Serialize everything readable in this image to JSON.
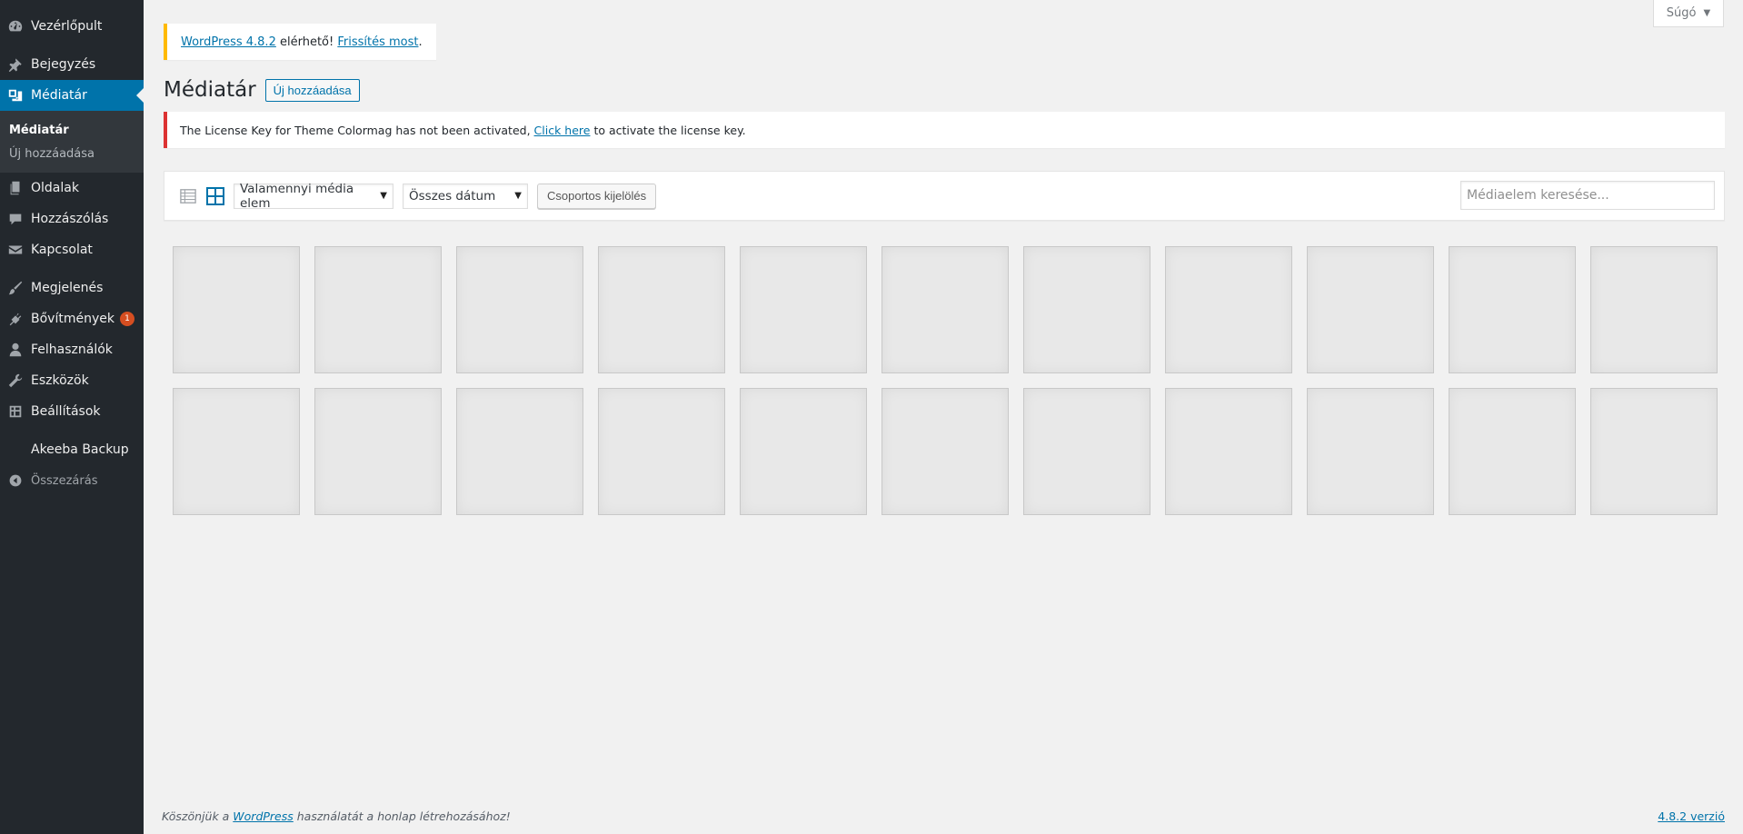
{
  "sidebar": {
    "items": [
      {
        "label": "Vezérlőpult",
        "icon": "dashboard-icon"
      },
      {
        "label": "Bejegyzés",
        "icon": "pin-icon"
      },
      {
        "label": "Médiatár",
        "icon": "media-icon"
      },
      {
        "label": "Oldalak",
        "icon": "pages-icon"
      },
      {
        "label": "Hozzászólás",
        "icon": "comments-icon"
      },
      {
        "label": "Kapcsolat",
        "icon": "mail-icon"
      },
      {
        "label": "Megjelenés",
        "icon": "brush-icon"
      },
      {
        "label": "Bővítmények",
        "icon": "plugins-icon",
        "badge": "1"
      },
      {
        "label": "Felhasználók",
        "icon": "users-icon"
      },
      {
        "label": "Eszközök",
        "icon": "tools-icon"
      },
      {
        "label": "Beállítások",
        "icon": "settings-icon"
      },
      {
        "label": "Akeeba Backup",
        "icon": ""
      },
      {
        "label": "Összezárás",
        "icon": "collapse-icon"
      }
    ],
    "submenu": [
      {
        "label": "Médiatár"
      },
      {
        "label": "Új hozzáadása"
      }
    ]
  },
  "help": {
    "label": "Súgó",
    "caret": "▼"
  },
  "update_nag": {
    "link1": "WordPress 4.8.2",
    "text": " elérhető! ",
    "link2": "Frissítés most",
    "end": "."
  },
  "page": {
    "title": "Médiatár",
    "add_new": "Új hozzáadása"
  },
  "license_notice": {
    "before": "The License Key for Theme Colormag has not been activated, ",
    "link": "Click here",
    "after": " to activate the license key."
  },
  "toolbar": {
    "type_filter": "Valamennyi média elem",
    "date_filter": "Összes dátum",
    "bulk_select": "Csoportos kijelölés",
    "search_placeholder": "Médiaelem keresése..."
  },
  "footer": {
    "before": "Köszönjük a ",
    "link": "WordPress",
    "after": " használatát a honlap létrehozásához!",
    "version": "4.8.2 verzió"
  },
  "colors": {
    "sidebar_bg": "#23282d",
    "active_bg": "#0073aa",
    "link": "#0073aa",
    "nag_border": "#ffba00",
    "error_border": "#dc3232",
    "badge": "#d54e21"
  }
}
